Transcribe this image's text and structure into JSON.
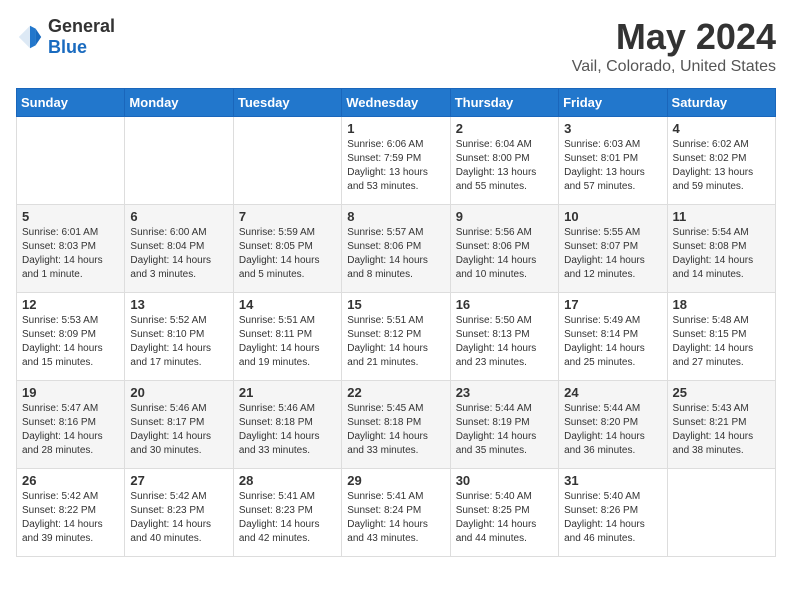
{
  "header": {
    "logo_general": "General",
    "logo_blue": "Blue",
    "month": "May 2024",
    "location": "Vail, Colorado, United States"
  },
  "days_of_week": [
    "Sunday",
    "Monday",
    "Tuesday",
    "Wednesday",
    "Thursday",
    "Friday",
    "Saturday"
  ],
  "weeks": [
    [
      {
        "day": "",
        "sunrise": "",
        "sunset": "",
        "daylight": ""
      },
      {
        "day": "",
        "sunrise": "",
        "sunset": "",
        "daylight": ""
      },
      {
        "day": "",
        "sunrise": "",
        "sunset": "",
        "daylight": ""
      },
      {
        "day": "1",
        "sunrise": "Sunrise: 6:06 AM",
        "sunset": "Sunset: 7:59 PM",
        "daylight": "Daylight: 13 hours and 53 minutes."
      },
      {
        "day": "2",
        "sunrise": "Sunrise: 6:04 AM",
        "sunset": "Sunset: 8:00 PM",
        "daylight": "Daylight: 13 hours and 55 minutes."
      },
      {
        "day": "3",
        "sunrise": "Sunrise: 6:03 AM",
        "sunset": "Sunset: 8:01 PM",
        "daylight": "Daylight: 13 hours and 57 minutes."
      },
      {
        "day": "4",
        "sunrise": "Sunrise: 6:02 AM",
        "sunset": "Sunset: 8:02 PM",
        "daylight": "Daylight: 13 hours and 59 minutes."
      }
    ],
    [
      {
        "day": "5",
        "sunrise": "Sunrise: 6:01 AM",
        "sunset": "Sunset: 8:03 PM",
        "daylight": "Daylight: 14 hours and 1 minute."
      },
      {
        "day": "6",
        "sunrise": "Sunrise: 6:00 AM",
        "sunset": "Sunset: 8:04 PM",
        "daylight": "Daylight: 14 hours and 3 minutes."
      },
      {
        "day": "7",
        "sunrise": "Sunrise: 5:59 AM",
        "sunset": "Sunset: 8:05 PM",
        "daylight": "Daylight: 14 hours and 5 minutes."
      },
      {
        "day": "8",
        "sunrise": "Sunrise: 5:57 AM",
        "sunset": "Sunset: 8:06 PM",
        "daylight": "Daylight: 14 hours and 8 minutes."
      },
      {
        "day": "9",
        "sunrise": "Sunrise: 5:56 AM",
        "sunset": "Sunset: 8:06 PM",
        "daylight": "Daylight: 14 hours and 10 minutes."
      },
      {
        "day": "10",
        "sunrise": "Sunrise: 5:55 AM",
        "sunset": "Sunset: 8:07 PM",
        "daylight": "Daylight: 14 hours and 12 minutes."
      },
      {
        "day": "11",
        "sunrise": "Sunrise: 5:54 AM",
        "sunset": "Sunset: 8:08 PM",
        "daylight": "Daylight: 14 hours and 14 minutes."
      }
    ],
    [
      {
        "day": "12",
        "sunrise": "Sunrise: 5:53 AM",
        "sunset": "Sunset: 8:09 PM",
        "daylight": "Daylight: 14 hours and 15 minutes."
      },
      {
        "day": "13",
        "sunrise": "Sunrise: 5:52 AM",
        "sunset": "Sunset: 8:10 PM",
        "daylight": "Daylight: 14 hours and 17 minutes."
      },
      {
        "day": "14",
        "sunrise": "Sunrise: 5:51 AM",
        "sunset": "Sunset: 8:11 PM",
        "daylight": "Daylight: 14 hours and 19 minutes."
      },
      {
        "day": "15",
        "sunrise": "Sunrise: 5:51 AM",
        "sunset": "Sunset: 8:12 PM",
        "daylight": "Daylight: 14 hours and 21 minutes."
      },
      {
        "day": "16",
        "sunrise": "Sunrise: 5:50 AM",
        "sunset": "Sunset: 8:13 PM",
        "daylight": "Daylight: 14 hours and 23 minutes."
      },
      {
        "day": "17",
        "sunrise": "Sunrise: 5:49 AM",
        "sunset": "Sunset: 8:14 PM",
        "daylight": "Daylight: 14 hours and 25 minutes."
      },
      {
        "day": "18",
        "sunrise": "Sunrise: 5:48 AM",
        "sunset": "Sunset: 8:15 PM",
        "daylight": "Daylight: 14 hours and 27 minutes."
      }
    ],
    [
      {
        "day": "19",
        "sunrise": "Sunrise: 5:47 AM",
        "sunset": "Sunset: 8:16 PM",
        "daylight": "Daylight: 14 hours and 28 minutes."
      },
      {
        "day": "20",
        "sunrise": "Sunrise: 5:46 AM",
        "sunset": "Sunset: 8:17 PM",
        "daylight": "Daylight: 14 hours and 30 minutes."
      },
      {
        "day": "21",
        "sunrise": "Sunrise: 5:46 AM",
        "sunset": "Sunset: 8:18 PM",
        "daylight": "Daylight: 14 hours and 33 minutes."
      },
      {
        "day": "22",
        "sunrise": "Sunrise: 5:45 AM",
        "sunset": "Sunset: 8:18 PM",
        "daylight": "Daylight: 14 hours and 33 minutes."
      },
      {
        "day": "23",
        "sunrise": "Sunrise: 5:44 AM",
        "sunset": "Sunset: 8:19 PM",
        "daylight": "Daylight: 14 hours and 35 minutes."
      },
      {
        "day": "24",
        "sunrise": "Sunrise: 5:44 AM",
        "sunset": "Sunset: 8:20 PM",
        "daylight": "Daylight: 14 hours and 36 minutes."
      },
      {
        "day": "25",
        "sunrise": "Sunrise: 5:43 AM",
        "sunset": "Sunset: 8:21 PM",
        "daylight": "Daylight: 14 hours and 38 minutes."
      }
    ],
    [
      {
        "day": "26",
        "sunrise": "Sunrise: 5:42 AM",
        "sunset": "Sunset: 8:22 PM",
        "daylight": "Daylight: 14 hours and 39 minutes."
      },
      {
        "day": "27",
        "sunrise": "Sunrise: 5:42 AM",
        "sunset": "Sunset: 8:23 PM",
        "daylight": "Daylight: 14 hours and 40 minutes."
      },
      {
        "day": "28",
        "sunrise": "Sunrise: 5:41 AM",
        "sunset": "Sunset: 8:23 PM",
        "daylight": "Daylight: 14 hours and 42 minutes."
      },
      {
        "day": "29",
        "sunrise": "Sunrise: 5:41 AM",
        "sunset": "Sunset: 8:24 PM",
        "daylight": "Daylight: 14 hours and 43 minutes."
      },
      {
        "day": "30",
        "sunrise": "Sunrise: 5:40 AM",
        "sunset": "Sunset: 8:25 PM",
        "daylight": "Daylight: 14 hours and 44 minutes."
      },
      {
        "day": "31",
        "sunrise": "Sunrise: 5:40 AM",
        "sunset": "Sunset: 8:26 PM",
        "daylight": "Daylight: 14 hours and 46 minutes."
      },
      {
        "day": "",
        "sunrise": "",
        "sunset": "",
        "daylight": ""
      }
    ]
  ]
}
